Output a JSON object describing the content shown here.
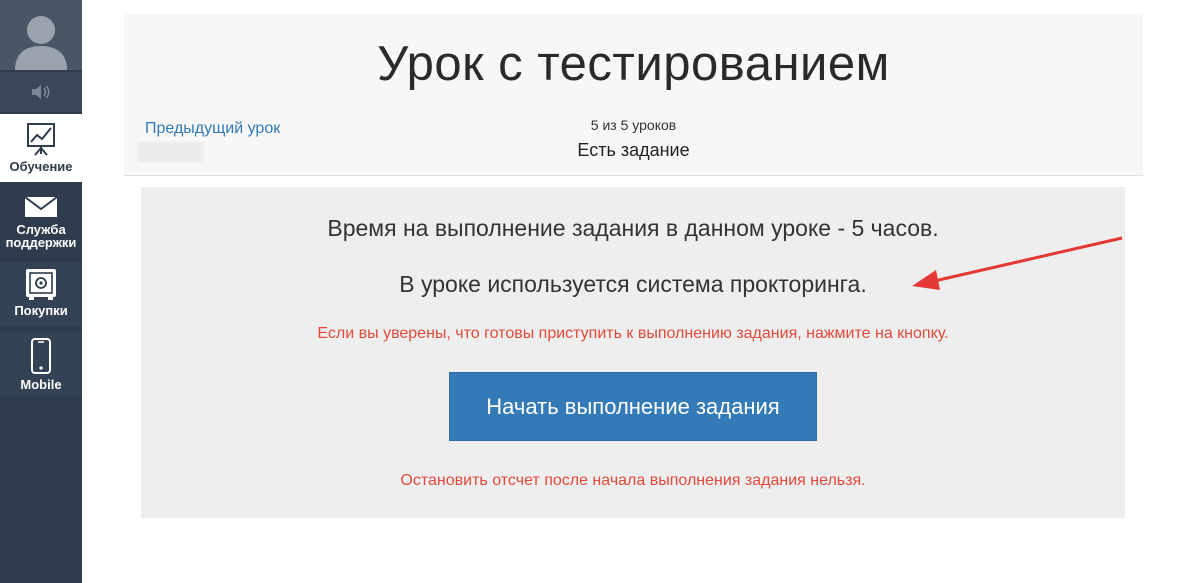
{
  "sidebar": {
    "items": [
      {
        "label": "Обучение",
        "icon": "chart-board-icon",
        "active": true
      },
      {
        "label": "Служба поддержки",
        "icon": "envelope-icon",
        "active": false
      },
      {
        "label": "Покупки",
        "icon": "safe-icon",
        "active": false
      },
      {
        "label": "Mobile",
        "icon": "phone-icon",
        "active": false
      }
    ]
  },
  "header": {
    "title": "Урок с тестированием",
    "prev_link": "Предыдущий урок",
    "counter": "5 из 5 уроков",
    "status": "Есть задание"
  },
  "task": {
    "time_text": "Время на выполнение задания в данном уроке - 5 часов.",
    "proctoring_text": "В уроке используется система прокторинга.",
    "warning_start": "Если вы уверены, что готовы приступить к выполнению задания, нажмите на кнопку.",
    "start_button": "Начать выполнение задания",
    "warning_stop": "Остановить отсчет после начала выполнения задания нельзя."
  },
  "colors": {
    "sidebar_bg": "#2e3c4e",
    "primary_button": "#337ab7",
    "warning_text": "#e24a3b",
    "annotation_arrow": "#e53935"
  }
}
